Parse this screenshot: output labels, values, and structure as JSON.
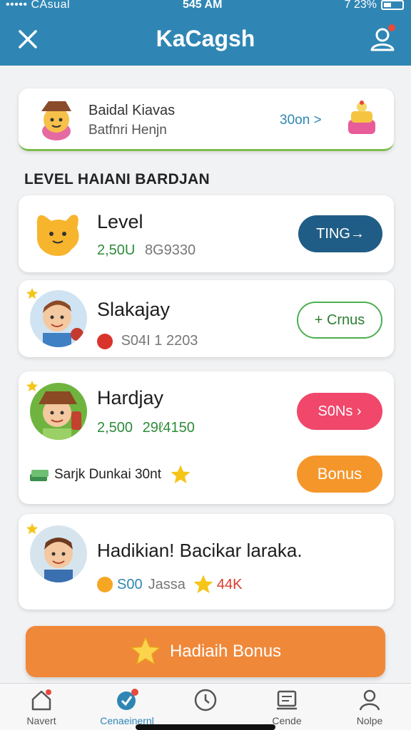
{
  "status_bar": {
    "carrier": "••••• CAsual",
    "time": "545 AM",
    "battery": "7 23%"
  },
  "header": {
    "title": "KaCagsh"
  },
  "profile": {
    "name": "Baidal Kiavas",
    "subtitle": "Batfnri Henjn",
    "link": "30on >"
  },
  "section": {
    "title": "LEVEL HAIANI BARDJAN"
  },
  "items": [
    {
      "title": "Level",
      "meta_primary": "2,50U",
      "meta_secondary": "8G9330",
      "button": "TING→"
    },
    {
      "title": "Slakajay",
      "meta_primary": "",
      "meta_secondary": "S04I 1 2203",
      "button": "+ Crnus"
    },
    {
      "title": "Hardjay",
      "meta_primary": "2,500",
      "meta_secondary": "29ℓ4150",
      "button": "S0Ns ›",
      "extra_text": "Sarjk Dunkai 30nt",
      "extra_button": "Bonus"
    },
    {
      "title": "Hadikian! Bacikar laraka.",
      "meta_primary": "S00",
      "meta_secondary": "Jassa",
      "meta_tertiary": "44K"
    }
  ],
  "bonus": {
    "label": "Hadiaih Bonus"
  },
  "tabs": [
    {
      "label": "Navert"
    },
    {
      "label": "Cenaeinernl"
    },
    {
      "label": ""
    },
    {
      "label": "Cende"
    },
    {
      "label": "Nolpe"
    }
  ],
  "colors": {
    "header": "#2f86b4",
    "accent_orange": "#f0883a",
    "pink": "#f0476b",
    "green": "#4caf50",
    "navy": "#205d86"
  }
}
